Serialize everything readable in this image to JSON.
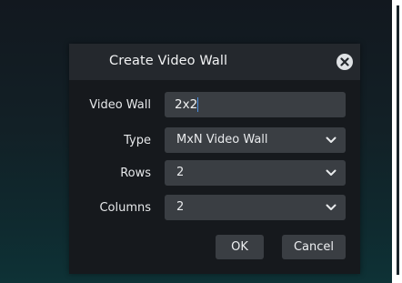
{
  "dialog": {
    "title": "Create Video Wall",
    "close_icon": "close-icon"
  },
  "form": {
    "video_wall": {
      "label": "Video Wall",
      "value": "2x2"
    },
    "type": {
      "label": "Type",
      "value": "MxN Video Wall",
      "icon": "chevron-down-icon"
    },
    "rows": {
      "label": "Rows",
      "value": "2",
      "icon": "chevron-down-icon"
    },
    "columns": {
      "label": "Columns",
      "value": "2",
      "icon": "chevron-down-icon"
    }
  },
  "buttons": {
    "ok_label": "OK",
    "cancel_label": "Cancel"
  }
}
